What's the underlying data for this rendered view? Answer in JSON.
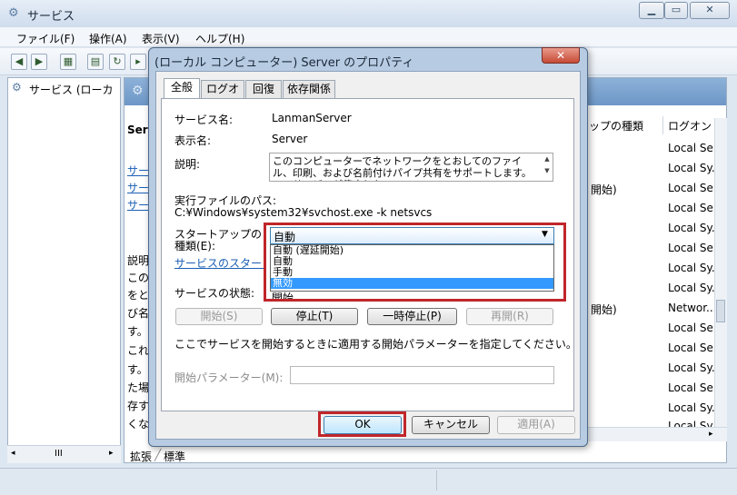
{
  "main": {
    "title": "サービス",
    "menu": [
      "ファイル(F)",
      "操作(A)",
      "表示(V)",
      "ヘルプ(H)"
    ],
    "tree_item": "サービス (ローカ",
    "pane_heading": "Ser",
    "left_links": [
      "サー",
      "サー",
      "サー"
    ],
    "left_text": [
      "説明",
      "この",
      "をと",
      "び名",
      "す。",
      "これ",
      "す。",
      "た場",
      "存す",
      "くな"
    ],
    "column_startup": "ップの種類",
    "column_logon": "ログオン",
    "logon_cells": [
      "Local Se",
      "Local Sy...",
      "Local Se",
      "Local Se",
      "Local Sy...",
      "Local Se",
      "Local Sy...",
      "Local Sy...",
      "Networ...",
      "Local Se",
      "Local Se",
      "Local Sy...",
      "Local Se",
      "Local Sy...",
      "Local Sy..."
    ],
    "startup_cells": [
      "開始)",
      "開始)"
    ],
    "bottom_tabs": [
      "拡張",
      "標準"
    ],
    "hscroll_label": "III"
  },
  "dialog": {
    "title": "(ローカル コンピューター) Server のプロパティ",
    "close": "✕",
    "tabs": [
      "全般",
      "ログオン",
      "回復",
      "依存関係"
    ],
    "service_name_label": "サービス名:",
    "service_name_value": "LanmanServer",
    "display_name_label": "表示名:",
    "display_name_value": "Server",
    "description_label": "説明:",
    "description_value": "このコンピューターでネットワークをとおしてのファイル、印刷、および名前付けパイプ共有をサポートします。このサービスが停止した",
    "path_label": "実行ファイルのパス:",
    "path_value": "C:¥Windows¥system32¥svchost.exe -k netsvcs",
    "startup_label_line1": "スタートアップの",
    "startup_label_line2": "種類(E):",
    "startup_selected": "自動",
    "startup_options": [
      "自動 (遅延開始)",
      "自動",
      "手動",
      "無効"
    ],
    "startup_link": "サービスのスタートアップ",
    "status_label": "サービスの状態:",
    "status_value": "開始",
    "buttons": {
      "start": "開始(S)",
      "stop": "停止(T)",
      "pause": "一時停止(P)",
      "resume": "再開(R)"
    },
    "hint": "ここでサービスを開始するときに適用する開始パラメーターを指定してください。",
    "param_label": "開始パラメーター(M):",
    "param_value": "",
    "ok": "OK",
    "cancel": "キャンセル",
    "apply": "適用(A)"
  },
  "colors": {
    "highlight_red": "#c0262a",
    "selection_blue": "#3399ff",
    "link_blue": "#1a5fb4"
  }
}
